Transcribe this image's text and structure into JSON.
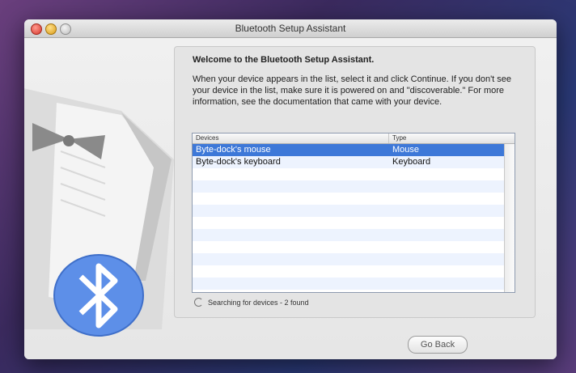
{
  "window": {
    "title": "Bluetooth Setup Assistant"
  },
  "panel": {
    "welcome": "Welcome to the Bluetooth Setup Assistant.",
    "instructions": "When your device appears in the list, select it and click Continue. If you don't see your device in the list, make sure it is powered on and \"discoverable.\" For more information, see the documentation that came with your device."
  },
  "device_table": {
    "headers": {
      "devices": "Devices",
      "type": "Type"
    },
    "rows": [
      {
        "name": "Byte-dock's mouse",
        "type": "Mouse",
        "selected": true
      },
      {
        "name": "Byte-dock's keyboard",
        "type": "Keyboard",
        "selected": false
      }
    ]
  },
  "status": {
    "text": "Searching for devices - 2 found"
  },
  "buttons": {
    "go_back": "Go Back"
  },
  "colors": {
    "selection": "#3d78d8",
    "bluetooth_blue": "#5d8fe8"
  }
}
